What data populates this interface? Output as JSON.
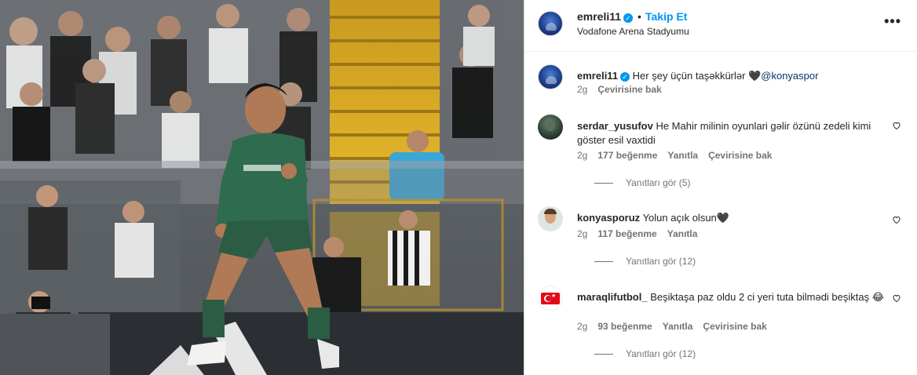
{
  "post": {
    "username": "emreli11",
    "follow_label": "Takip Et",
    "dot": "•",
    "location": "Vodafone Arena Stadyumu",
    "more_label": "•••",
    "caption_user": "emreli11",
    "caption_text": "Her şey üçün taşəkkürlər 🖤",
    "caption_mention": "@konyaspor",
    "caption_time": "2g",
    "caption_translate": "Çevirisine bak"
  },
  "comments": [
    {
      "user": "serdar_yusufov",
      "text": "He Mahir milinin oyunlari gəlir özünü zedeli kimi göster esil vaxtidi",
      "time": "2g",
      "likes": "177 beğenme",
      "reply": "Yanıtla",
      "translate": "Çevirisine bak",
      "view_replies": "Yanıtları gör (5)"
    },
    {
      "user": "konyasporuz",
      "text": "Yolun açık olsun🖤",
      "time": "2g",
      "likes": "117 beğenme",
      "reply": "Yanıtla",
      "view_replies": "Yanıtları gör (12)"
    },
    {
      "user": "maraqlifutbol_",
      "text": "Beşiktaşa paz oldu 2 ci yeri tuta bilmədi beşiktaş 😂",
      "time": "2g",
      "likes": "93 beğenme",
      "reply": "Yanıtla",
      "translate": "Çevirisine bak",
      "view_replies": "Yanıtları gör (12)"
    }
  ],
  "colors": {
    "accent": "#0095f6",
    "mention": "#00376b",
    "muted": "#737373",
    "jersey": "#2f6b4f",
    "stairs": "#e0b22a"
  },
  "icons": {
    "verified": "verified-badge-icon",
    "like": "heart-icon",
    "more": "more-options-icon"
  }
}
